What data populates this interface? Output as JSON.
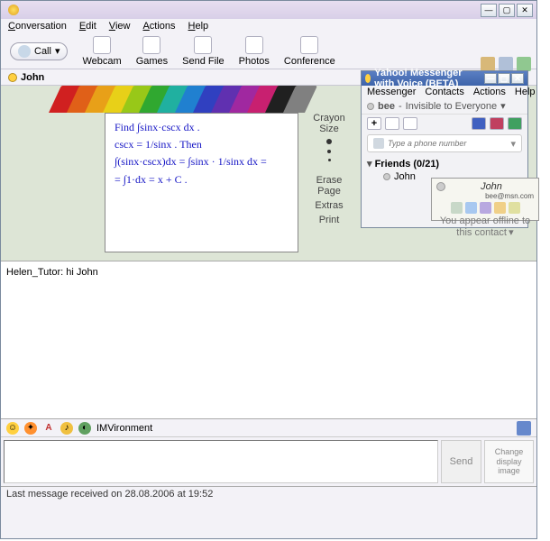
{
  "main": {
    "menu": [
      "Conversation",
      "Edit",
      "View",
      "Actions",
      "Help"
    ],
    "toolbar": {
      "call": "Call",
      "items": [
        "Webcam",
        "Games",
        "Send File",
        "Photos",
        "Conference"
      ]
    },
    "tab": {
      "label": "John"
    },
    "whiteboard": {
      "crayon_colors": [
        "#d02020",
        "#e06018",
        "#e8a018",
        "#e8d018",
        "#98c818",
        "#30a830",
        "#20b0a0",
        "#2080d0",
        "#3040c0",
        "#6030b0",
        "#a028a0",
        "#c82070",
        "#202020",
        "#808080"
      ],
      "math": [
        "Find  ∫sinx·cscx dx .",
        "cscx = 1/sinx .   Then",
        "∫(sinx·cscx)dx = ∫sinx · 1/sinx dx =",
        "= ∫1·dx = x + C ."
      ],
      "tools": {
        "crayon_size": "Crayon Size",
        "erase_page": "Erase Page",
        "extras": "Extras",
        "print": "Print"
      }
    },
    "chat": {
      "sender": "Helen_Tutor:",
      "text": "hi John"
    },
    "imv": "IMVironment",
    "send": "Send",
    "display_image": "Change display image",
    "status": "Last message received on 28.08.2006 at 19:52"
  },
  "ym": {
    "title": "Yahoo! Messenger with Voice (BETA)",
    "menu": [
      "Messenger",
      "Contacts",
      "Actions",
      "Help"
    ],
    "status": {
      "name": "bee",
      "text": "Invisible to Everyone"
    },
    "phone_placeholder": "Type a phone number",
    "group": "Friends (0/21)",
    "contact": "John"
  },
  "contact_card": {
    "name": "John",
    "email": "bee@msn.com",
    "status": "You appear offline to this contact"
  }
}
